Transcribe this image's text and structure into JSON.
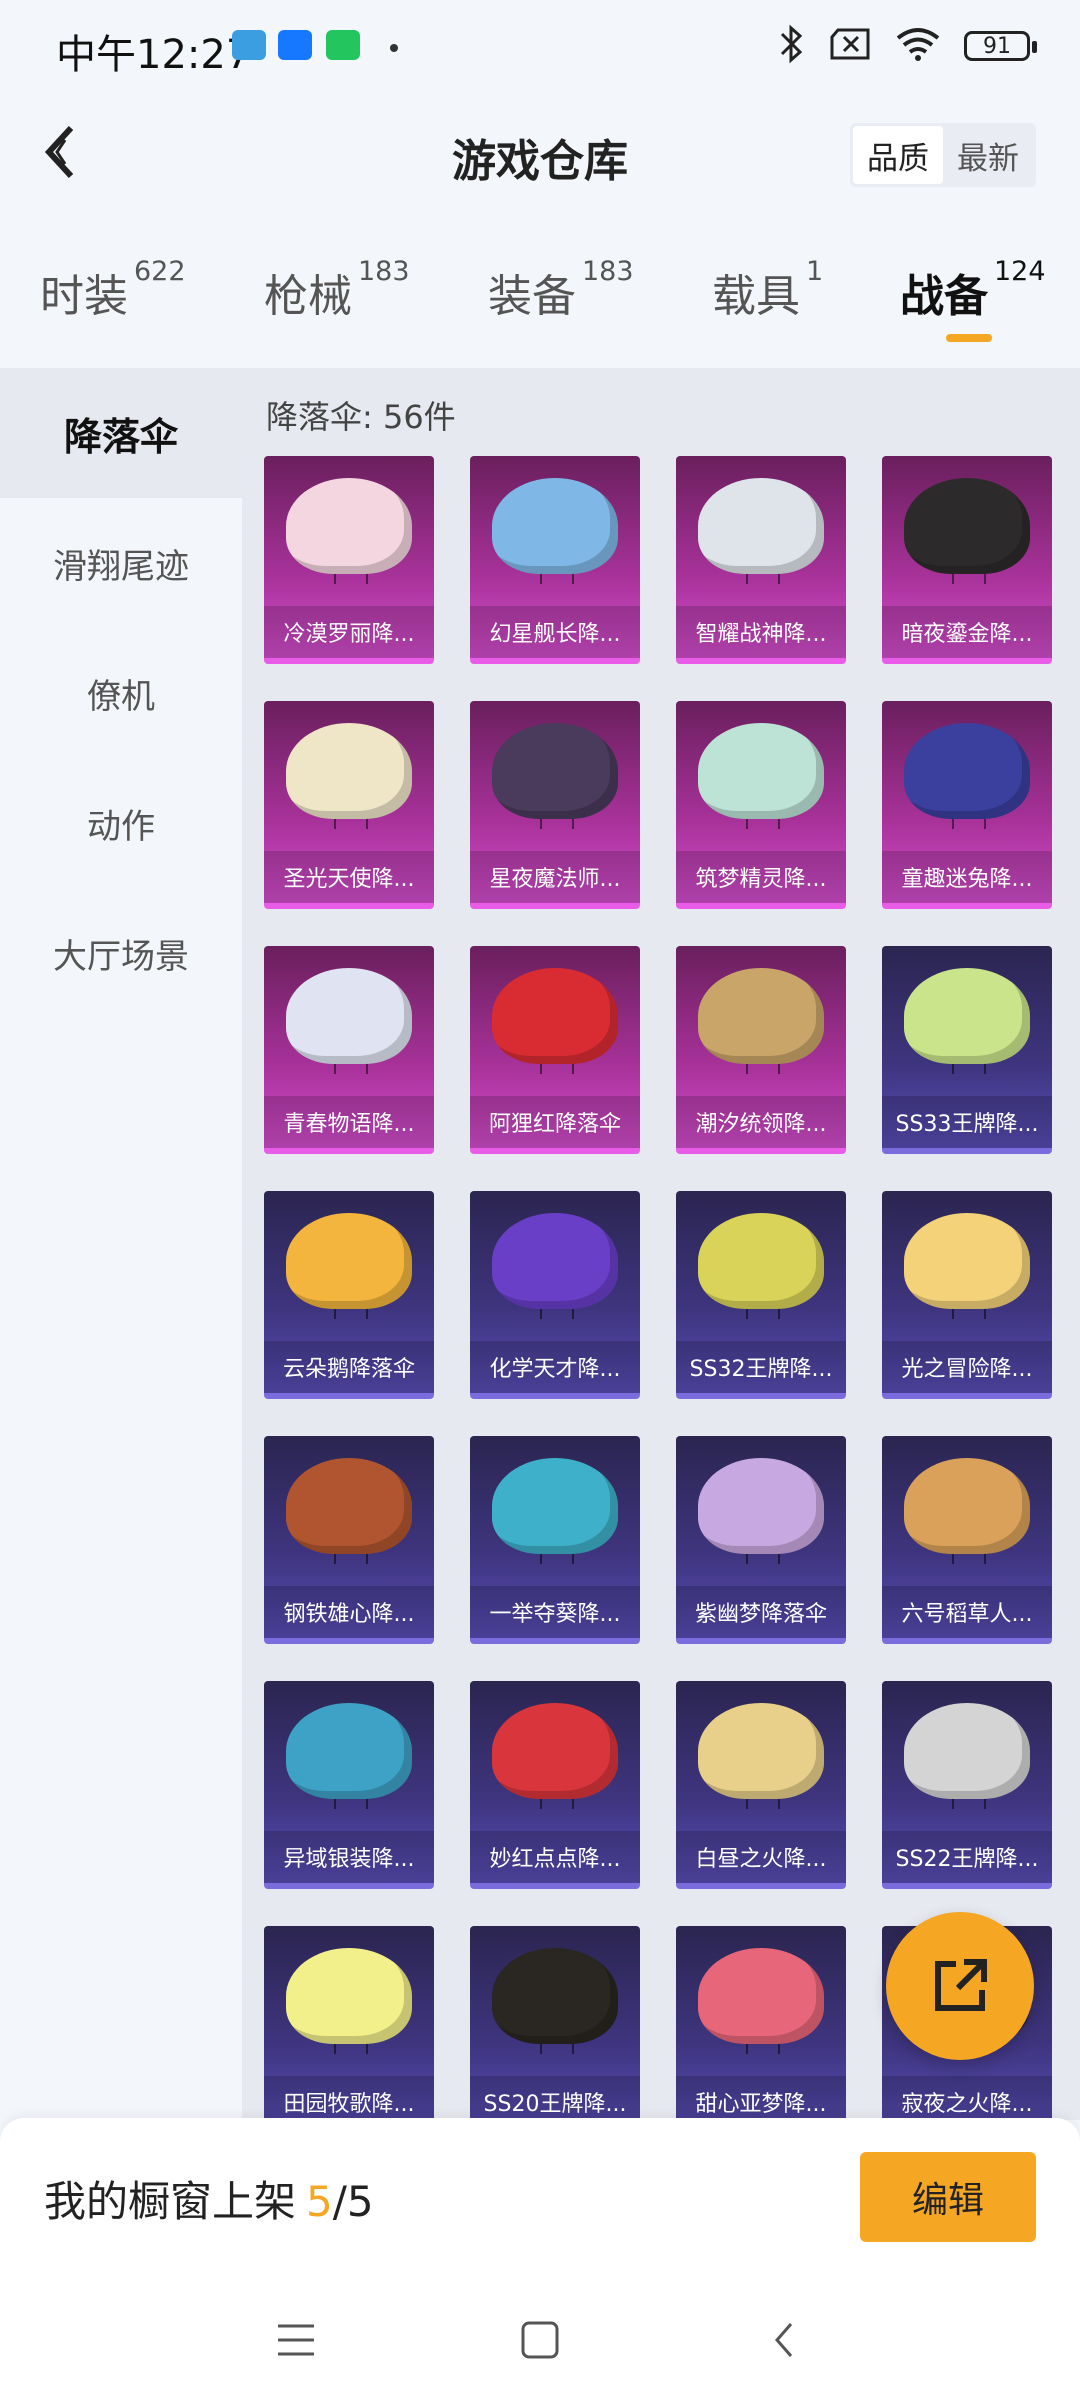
{
  "status_bar": {
    "time": "中午12:27",
    "battery": "91",
    "notif_colors": [
      "#3a9ee0",
      "#1677ff",
      "#22c55e"
    ]
  },
  "header": {
    "title": "游戏仓库",
    "sort": {
      "quality_label": "品质",
      "newest_label": "最新"
    }
  },
  "tabs": [
    {
      "label": "时装",
      "count": "622"
    },
    {
      "label": "枪械",
      "count": "183"
    },
    {
      "label": "装备",
      "count": "183"
    },
    {
      "label": "载具",
      "count": "1"
    },
    {
      "label": "战备",
      "count": "124"
    }
  ],
  "sidebar": {
    "items": [
      {
        "label": "降落伞"
      },
      {
        "label": "滑翔尾迹"
      },
      {
        "label": "僚机"
      },
      {
        "label": "动作"
      },
      {
        "label": "大厅场景"
      }
    ]
  },
  "content": {
    "count_label": "降落伞: 56件",
    "items": [
      {
        "name": "冷漠罗丽降...",
        "rarity": "legend",
        "color": "#f4d6e0"
      },
      {
        "name": "幻星舰长降...",
        "rarity": "legend",
        "color": "#7fb8e6"
      },
      {
        "name": "智耀战神降...",
        "rarity": "legend",
        "color": "#dfe3ea"
      },
      {
        "name": "暗夜鎏金降...",
        "rarity": "legend",
        "color": "#2c2a2a"
      },
      {
        "name": "圣光天使降...",
        "rarity": "legend",
        "color": "#efe6c8"
      },
      {
        "name": "星夜魔法师...",
        "rarity": "legend",
        "color": "#4a3a5c"
      },
      {
        "name": "筑梦精灵降...",
        "rarity": "legend",
        "color": "#bde3d6"
      },
      {
        "name": "童趣迷兔降...",
        "rarity": "legend",
        "color": "#3b3f9e"
      },
      {
        "name": "青春物语降...",
        "rarity": "legend",
        "color": "#e0e4f2"
      },
      {
        "name": "阿狸红降落伞",
        "rarity": "legend",
        "color": "#d92c32"
      },
      {
        "name": "潮汐统领降...",
        "rarity": "legend",
        "color": "#caa56a"
      },
      {
        "name": "SS33王牌降...",
        "rarity": "epic",
        "color": "#c9e48a"
      },
      {
        "name": "云朵鹅降落伞",
        "rarity": "epic",
        "color": "#f3b53e"
      },
      {
        "name": "化学天才降...",
        "rarity": "epic",
        "color": "#6a3fc8"
      },
      {
        "name": "SS32王牌降...",
        "rarity": "epic",
        "color": "#d9d35a"
      },
      {
        "name": "光之冒险降...",
        "rarity": "epic",
        "color": "#f4d27a"
      },
      {
        "name": "钢铁雄心降...",
        "rarity": "epic",
        "color": "#b05530"
      },
      {
        "name": "一举夺葵降...",
        "rarity": "epic",
        "color": "#3fb0c9"
      },
      {
        "name": "紫幽梦降落伞",
        "rarity": "epic",
        "color": "#c8a8e0"
      },
      {
        "name": "六号稻草人...",
        "rarity": "epic",
        "color": "#d9a15a"
      },
      {
        "name": "异域银装降...",
        "rarity": "epic",
        "color": "#3ea2c6"
      },
      {
        "name": "妙红点点降...",
        "rarity": "epic",
        "color": "#d8353c"
      },
      {
        "name": "白昼之火降...",
        "rarity": "epic",
        "color": "#e8cf8a"
      },
      {
        "name": "SS22王牌降...",
        "rarity": "epic",
        "color": "#d4d4d4"
      },
      {
        "name": "田园牧歌降...",
        "rarity": "epic",
        "color": "#f2f08a"
      },
      {
        "name": "SS20王牌降...",
        "rarity": "epic",
        "color": "#2a2622"
      },
      {
        "name": "甜心亚梦降...",
        "rarity": "epic",
        "color": "#e8667a"
      },
      {
        "name": "寂夜之火降...",
        "rarity": "epic",
        "color": "#2a2a3a"
      }
    ]
  },
  "bottom_bar": {
    "label": "我的橱窗上架",
    "current": "5",
    "total": "/5",
    "edit_label": "编辑"
  },
  "colors": {
    "accent": "#f5a623",
    "legend_border": "#e85ce8",
    "epic_border": "#7a6cdd"
  }
}
